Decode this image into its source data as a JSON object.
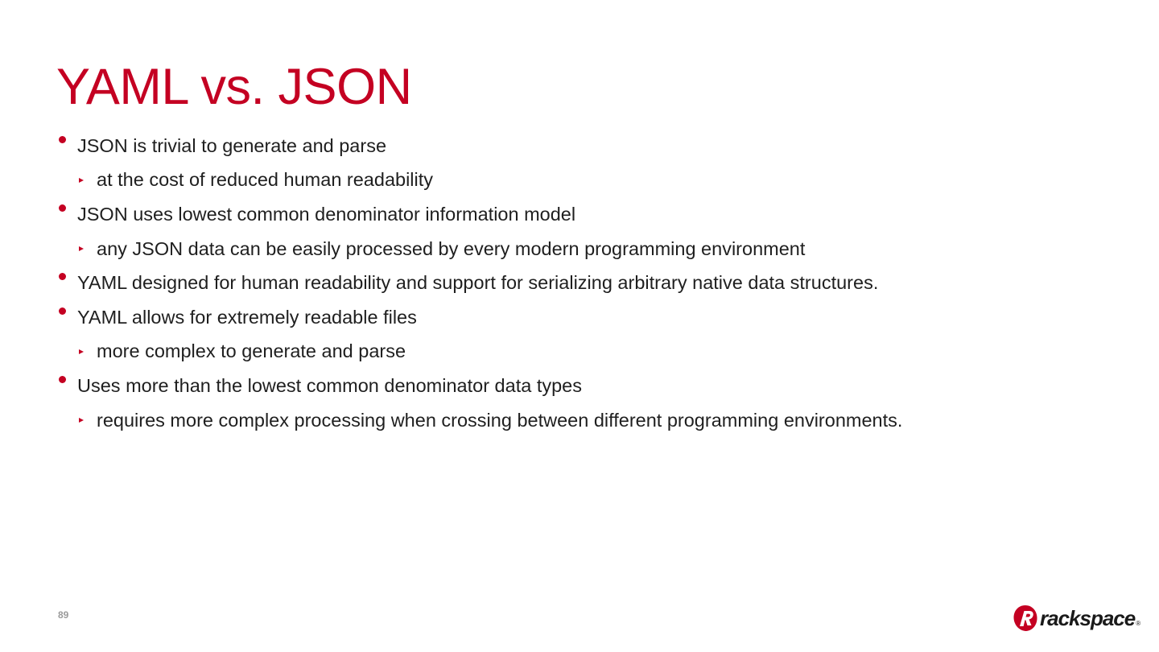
{
  "slide": {
    "title": "YAML vs. JSON",
    "page_number": "89",
    "bullets": [
      {
        "level": 1,
        "text": "JSON is trivial to generate and parse"
      },
      {
        "level": 2,
        "text": "at the cost of reduced human readability"
      },
      {
        "level": 1,
        "text": "JSON uses lowest common denominator information model"
      },
      {
        "level": 2,
        "text": "any JSON data can be easily processed by every modern programming environment"
      },
      {
        "level": 1,
        "text": "YAML designed for human readability and support for serializing arbitrary native data structures."
      },
      {
        "level": 1,
        "text": "YAML allows for extremely readable files"
      },
      {
        "level": 2,
        "text": "more complex to generate and parse"
      },
      {
        "level": 1,
        "text": "Uses more than the lowest common denominator data types"
      },
      {
        "level": 2,
        "text": "requires more complex processing when crossing between different programming environments."
      }
    ]
  },
  "logo": {
    "text": "rackspace",
    "registered": "®",
    "icon": "rackspace-logo-icon"
  },
  "colors": {
    "accent": "#c40022",
    "text": "#1f1f1f",
    "page_number": "#9a9a9a"
  }
}
